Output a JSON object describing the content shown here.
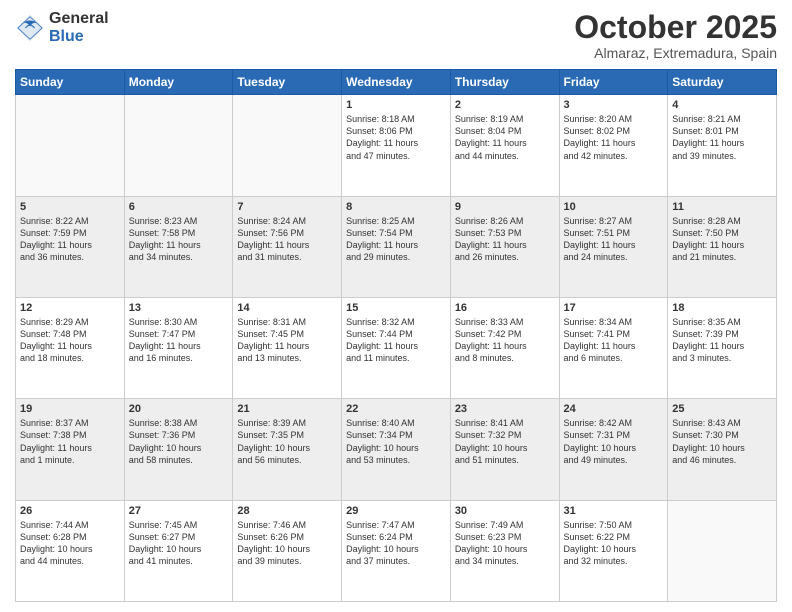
{
  "logo": {
    "general": "General",
    "blue": "Blue"
  },
  "title": "October 2025",
  "location": "Almaraz, Extremadura, Spain",
  "days_of_week": [
    "Sunday",
    "Monday",
    "Tuesday",
    "Wednesday",
    "Thursday",
    "Friday",
    "Saturday"
  ],
  "weeks": [
    [
      {
        "day": "",
        "info": ""
      },
      {
        "day": "",
        "info": ""
      },
      {
        "day": "",
        "info": ""
      },
      {
        "day": "1",
        "info": "Sunrise: 8:18 AM\nSunset: 8:06 PM\nDaylight: 11 hours\nand 47 minutes."
      },
      {
        "day": "2",
        "info": "Sunrise: 8:19 AM\nSunset: 8:04 PM\nDaylight: 11 hours\nand 44 minutes."
      },
      {
        "day": "3",
        "info": "Sunrise: 8:20 AM\nSunset: 8:02 PM\nDaylight: 11 hours\nand 42 minutes."
      },
      {
        "day": "4",
        "info": "Sunrise: 8:21 AM\nSunset: 8:01 PM\nDaylight: 11 hours\nand 39 minutes."
      }
    ],
    [
      {
        "day": "5",
        "info": "Sunrise: 8:22 AM\nSunset: 7:59 PM\nDaylight: 11 hours\nand 36 minutes."
      },
      {
        "day": "6",
        "info": "Sunrise: 8:23 AM\nSunset: 7:58 PM\nDaylight: 11 hours\nand 34 minutes."
      },
      {
        "day": "7",
        "info": "Sunrise: 8:24 AM\nSunset: 7:56 PM\nDaylight: 11 hours\nand 31 minutes."
      },
      {
        "day": "8",
        "info": "Sunrise: 8:25 AM\nSunset: 7:54 PM\nDaylight: 11 hours\nand 29 minutes."
      },
      {
        "day": "9",
        "info": "Sunrise: 8:26 AM\nSunset: 7:53 PM\nDaylight: 11 hours\nand 26 minutes."
      },
      {
        "day": "10",
        "info": "Sunrise: 8:27 AM\nSunset: 7:51 PM\nDaylight: 11 hours\nand 24 minutes."
      },
      {
        "day": "11",
        "info": "Sunrise: 8:28 AM\nSunset: 7:50 PM\nDaylight: 11 hours\nand 21 minutes."
      }
    ],
    [
      {
        "day": "12",
        "info": "Sunrise: 8:29 AM\nSunset: 7:48 PM\nDaylight: 11 hours\nand 18 minutes."
      },
      {
        "day": "13",
        "info": "Sunrise: 8:30 AM\nSunset: 7:47 PM\nDaylight: 11 hours\nand 16 minutes."
      },
      {
        "day": "14",
        "info": "Sunrise: 8:31 AM\nSunset: 7:45 PM\nDaylight: 11 hours\nand 13 minutes."
      },
      {
        "day": "15",
        "info": "Sunrise: 8:32 AM\nSunset: 7:44 PM\nDaylight: 11 hours\nand 11 minutes."
      },
      {
        "day": "16",
        "info": "Sunrise: 8:33 AM\nSunset: 7:42 PM\nDaylight: 11 hours\nand 8 minutes."
      },
      {
        "day": "17",
        "info": "Sunrise: 8:34 AM\nSunset: 7:41 PM\nDaylight: 11 hours\nand 6 minutes."
      },
      {
        "day": "18",
        "info": "Sunrise: 8:35 AM\nSunset: 7:39 PM\nDaylight: 11 hours\nand 3 minutes."
      }
    ],
    [
      {
        "day": "19",
        "info": "Sunrise: 8:37 AM\nSunset: 7:38 PM\nDaylight: 11 hours\nand 1 minute."
      },
      {
        "day": "20",
        "info": "Sunrise: 8:38 AM\nSunset: 7:36 PM\nDaylight: 10 hours\nand 58 minutes."
      },
      {
        "day": "21",
        "info": "Sunrise: 8:39 AM\nSunset: 7:35 PM\nDaylight: 10 hours\nand 56 minutes."
      },
      {
        "day": "22",
        "info": "Sunrise: 8:40 AM\nSunset: 7:34 PM\nDaylight: 10 hours\nand 53 minutes."
      },
      {
        "day": "23",
        "info": "Sunrise: 8:41 AM\nSunset: 7:32 PM\nDaylight: 10 hours\nand 51 minutes."
      },
      {
        "day": "24",
        "info": "Sunrise: 8:42 AM\nSunset: 7:31 PM\nDaylight: 10 hours\nand 49 minutes."
      },
      {
        "day": "25",
        "info": "Sunrise: 8:43 AM\nSunset: 7:30 PM\nDaylight: 10 hours\nand 46 minutes."
      }
    ],
    [
      {
        "day": "26",
        "info": "Sunrise: 7:44 AM\nSunset: 6:28 PM\nDaylight: 10 hours\nand 44 minutes."
      },
      {
        "day": "27",
        "info": "Sunrise: 7:45 AM\nSunset: 6:27 PM\nDaylight: 10 hours\nand 41 minutes."
      },
      {
        "day": "28",
        "info": "Sunrise: 7:46 AM\nSunset: 6:26 PM\nDaylight: 10 hours\nand 39 minutes."
      },
      {
        "day": "29",
        "info": "Sunrise: 7:47 AM\nSunset: 6:24 PM\nDaylight: 10 hours\nand 37 minutes."
      },
      {
        "day": "30",
        "info": "Sunrise: 7:49 AM\nSunset: 6:23 PM\nDaylight: 10 hours\nand 34 minutes."
      },
      {
        "day": "31",
        "info": "Sunrise: 7:50 AM\nSunset: 6:22 PM\nDaylight: 10 hours\nand 32 minutes."
      },
      {
        "day": "",
        "info": ""
      }
    ]
  ]
}
